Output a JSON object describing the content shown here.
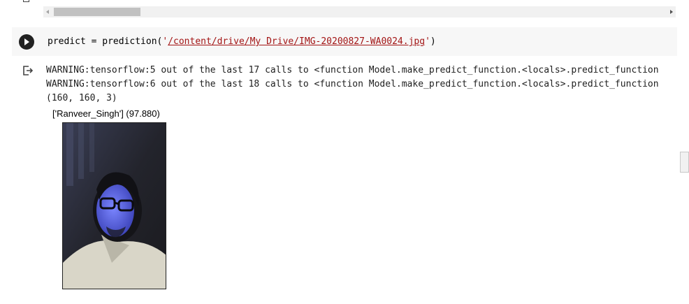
{
  "notebook": {
    "cell": {
      "code_prefix": "predict = prediction(",
      "quote_open": "'",
      "string_path": "/content/drive/My Drive/IMG-20200827-WA0024.jpg",
      "quote_close": "'",
      "code_suffix": ")"
    },
    "output": {
      "lines": [
        "WARNING:tensorflow:5 out of the last 17 calls to <function Model.make_predict_function.<locals>.predict_function",
        "WARNING:tensorflow:6 out of the last 18 calls to <function Model.make_predict_function.<locals>.predict_function",
        "(160, 160, 3)"
      ],
      "image_title": "['Ranveer_Singh'] (97.880)"
    }
  },
  "icons": {
    "run": "play-icon",
    "output": "output-redirect-icon"
  },
  "colors": {
    "cell_background": "#f7f7f7",
    "string": "#a31515",
    "run_button": "#212121"
  }
}
